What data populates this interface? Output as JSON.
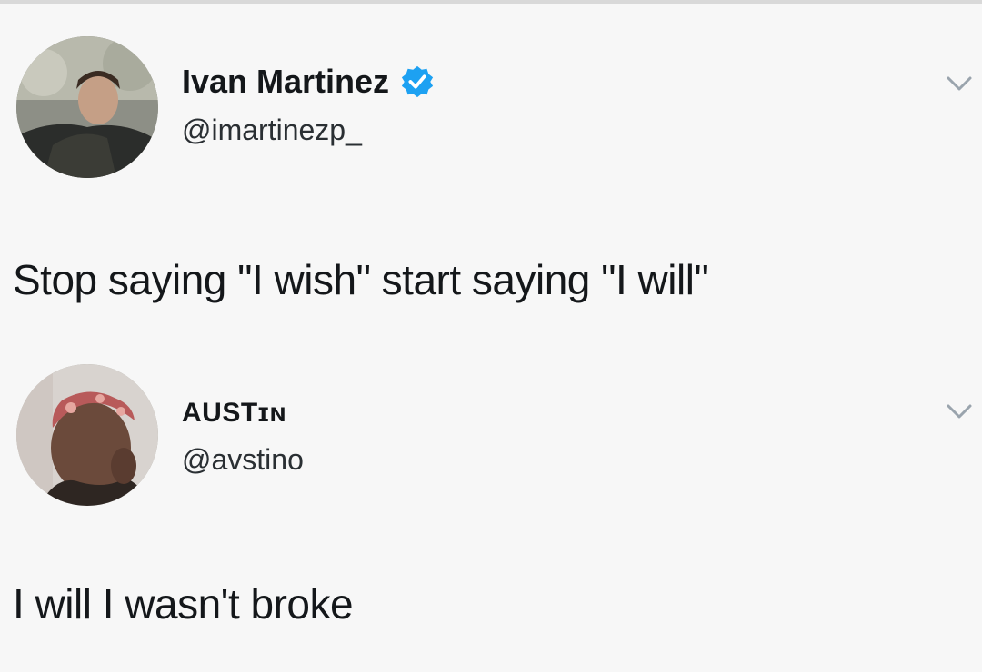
{
  "tweets": [
    {
      "display_name": "Ivan Martinez",
      "verified": true,
      "handle": "@imartinezp_",
      "text": "Stop saying \"I wish\" start saying \"I will\""
    },
    {
      "display_name": "AUSTɪɴ",
      "verified": false,
      "handle": "@avstino",
      "text": "I will I wasn't broke"
    }
  ],
  "icons": {
    "verified": "verified-badge-icon",
    "more": "chevron-down-icon"
  },
  "colors": {
    "background": "#f7f7f7",
    "text": "#14171a",
    "verified_blue": "#1da1f2",
    "chevron": "#9aa4ad"
  }
}
